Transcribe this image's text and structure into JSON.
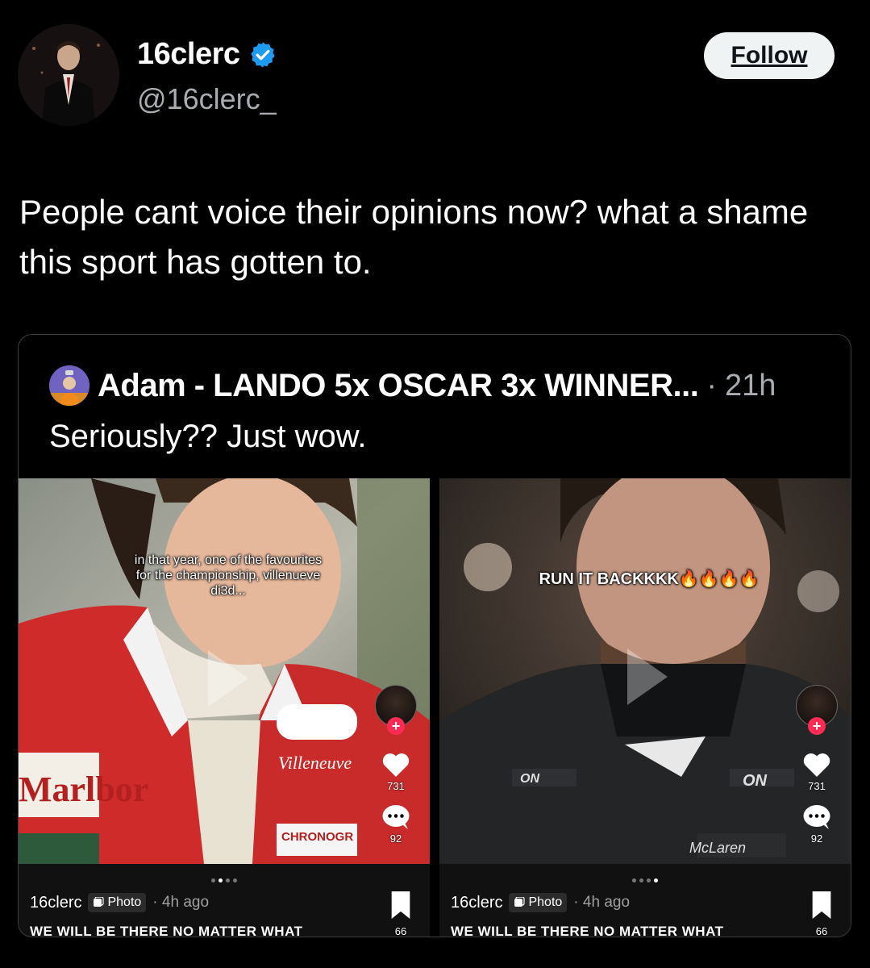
{
  "author": {
    "display_name": "16clerc",
    "handle": "@16clerc_",
    "verified": true,
    "avatar_icon": "avatar-man-in-suit"
  },
  "follow_label": "Follow",
  "tweet_text": "People cant voice their opinions now? what a shame this sport has gotten to.",
  "quote": {
    "author": "Adam - LANDO 5x OSCAR 3x WINNER...",
    "separator": "·",
    "time": "21h",
    "text": "Seriously?? Just wow.",
    "media": [
      {
        "caption": "in that year, one of the favourites for the championship, villenueve di3d...",
        "likes": "731",
        "comments": "92",
        "bookmarks": "66",
        "user": "16clerc",
        "badge": "Photo",
        "time": "· 4h ago",
        "tagline": "WE WILL BE THERE NO MATTER WHAT",
        "suit_text": [
          "Marlbor",
          "Villeneuve",
          "CHRONOGR"
        ]
      },
      {
        "caption": "RUN IT BACKKKK🔥🔥🔥🔥",
        "likes": "731",
        "comments": "92",
        "bookmarks": "66",
        "user": "16clerc",
        "badge": "Photo",
        "time": "· 4h ago",
        "tagline": "WE WILL BE THERE NO MATTER WHAT",
        "suit_text": [
          "ON",
          "McLaren"
        ]
      }
    ]
  },
  "colors": {
    "background": "#000000",
    "verified_blue": "#1d9bf0",
    "follow_bg": "#eff3f4",
    "secondary_text": "#a9adb1",
    "tiktok_red": "#fe2c55"
  }
}
